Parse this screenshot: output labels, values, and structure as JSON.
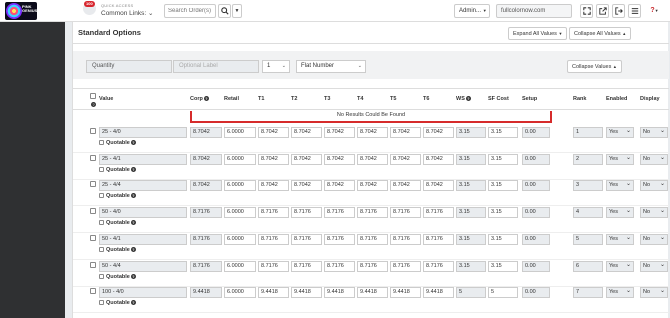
{
  "logo": {
    "text": "PINK GENIUS"
  },
  "quick_access": {
    "badge": "100",
    "label": "QUICK ACCESS",
    "select_value": "Common Links:"
  },
  "search": {
    "placeholder": "Search Order(s)"
  },
  "header": {
    "admin_label": "Admin...",
    "domain": "fullcolornow.com"
  },
  "card": {
    "title": "Standard Options",
    "expand_all": "Expand All Values",
    "collapse_all": "Collapse All Values"
  },
  "filters": {
    "quantity_label": "Quantity",
    "optional_label_placeholder": "Optional Label",
    "number_value": "1",
    "type_value": "Flat Number",
    "collapse_values": "Collapse Values"
  },
  "columns": {
    "value": "Value",
    "corp": "Corp",
    "retail": "Retail",
    "t1": "T1",
    "t2": "T2",
    "t3": "T3",
    "t4": "T4",
    "t5": "T5",
    "t6": "T6",
    "ws": "WS",
    "sf_cost": "SF Cost",
    "setup": "Setup",
    "rank": "Rank",
    "enabled": "Enabled",
    "display": "Display"
  },
  "no_results": "No Results Could Be Found",
  "quotable_label": "Quotable",
  "rows": [
    {
      "value": "25 - 4/0",
      "corp": "8.7042",
      "retail": "6.0000",
      "t1": "8.7042",
      "t2": "8.7042",
      "t3": "8.7042",
      "t4": "8.7042",
      "t5": "8.7042",
      "t6": "8.7042",
      "ws": "3.15",
      "sf_cost": "3.15",
      "setup": "0.00",
      "rank": "1",
      "enabled": "Yes",
      "display": "No"
    },
    {
      "value": "25 - 4/1",
      "corp": "8.7042",
      "retail": "6.0000",
      "t1": "8.7042",
      "t2": "8.7042",
      "t3": "8.7042",
      "t4": "8.7042",
      "t5": "8.7042",
      "t6": "8.7042",
      "ws": "3.15",
      "sf_cost": "3.15",
      "setup": "0.00",
      "rank": "2",
      "enabled": "Yes",
      "display": "No"
    },
    {
      "value": "25 - 4/4",
      "corp": "8.7042",
      "retail": "6.0000",
      "t1": "8.7042",
      "t2": "8.7042",
      "t3": "8.7042",
      "t4": "8.7042",
      "t5": "8.7042",
      "t6": "8.7042",
      "ws": "3.15",
      "sf_cost": "3.15",
      "setup": "0.00",
      "rank": "3",
      "enabled": "Yes",
      "display": "No"
    },
    {
      "value": "50 - 4/0",
      "corp": "8.7176",
      "retail": "6.0000",
      "t1": "8.7176",
      "t2": "8.7176",
      "t3": "8.7176",
      "t4": "8.7176",
      "t5": "8.7176",
      "t6": "8.7176",
      "ws": "3.15",
      "sf_cost": "3.15",
      "setup": "0.00",
      "rank": "4",
      "enabled": "Yes",
      "display": "No"
    },
    {
      "value": "50 - 4/1",
      "corp": "8.7176",
      "retail": "6.0000",
      "t1": "8.7176",
      "t2": "8.7176",
      "t3": "8.7176",
      "t4": "8.7176",
      "t5": "8.7176",
      "t6": "8.7176",
      "ws": "3.15",
      "sf_cost": "3.15",
      "setup": "0.00",
      "rank": "5",
      "enabled": "Yes",
      "display": "No"
    },
    {
      "value": "50 - 4/4",
      "corp": "8.7176",
      "retail": "6.0000",
      "t1": "8.7176",
      "t2": "8.7176",
      "t3": "8.7176",
      "t4": "8.7176",
      "t5": "8.7176",
      "t6": "8.7176",
      "ws": "3.15",
      "sf_cost": "3.15",
      "setup": "0.00",
      "rank": "6",
      "enabled": "Yes",
      "display": "No"
    },
    {
      "value": "100 - 4/0",
      "corp": "9.4418",
      "retail": "6.0000",
      "t1": "9.4418",
      "t2": "9.4418",
      "t3": "9.4418",
      "t4": "9.4418",
      "t5": "9.4418",
      "t6": "9.4418",
      "ws": "5",
      "sf_cost": "5",
      "setup": "0.00",
      "rank": "7",
      "enabled": "Yes",
      "display": "No"
    }
  ],
  "icons": {
    "search": "search-icon",
    "fullscreen": "fullscreen-icon",
    "external": "external-link-icon",
    "logout": "sign-out-icon",
    "menu": "menu-icon",
    "help": "help-circle-icon"
  },
  "colors": {
    "sidebar": "#2f3032",
    "error_border": "#d62b2b",
    "badge": "#d7262e"
  }
}
